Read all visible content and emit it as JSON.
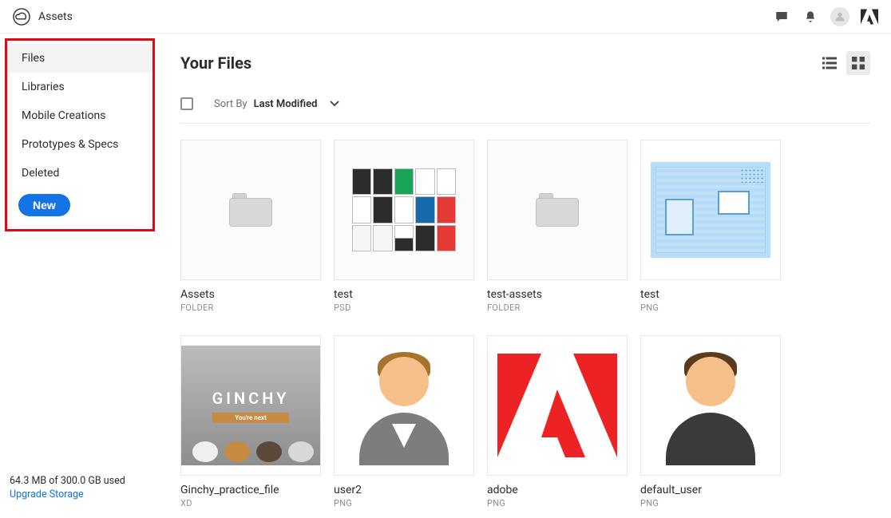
{
  "app_title": "Assets",
  "sidebar": {
    "items": [
      "Files",
      "Libraries",
      "Mobile Creations",
      "Prototypes & Specs",
      "Deleted"
    ],
    "active_index": 0,
    "new_button_label": "New"
  },
  "storage": {
    "usage_text": "64.3 MB of 300.0 GB used",
    "upgrade_text": "Upgrade Storage"
  },
  "main": {
    "title": "Your Files",
    "sort_by_label": "Sort By",
    "sort_by_value": "Last Modified",
    "view_mode": "grid"
  },
  "files": [
    {
      "name": "Assets",
      "type": "FOLDER",
      "kind": "folder"
    },
    {
      "name": "test",
      "type": "PSD",
      "kind": "psd"
    },
    {
      "name": "test-assets",
      "type": "FOLDER",
      "kind": "folder"
    },
    {
      "name": "test",
      "type": "PNG",
      "kind": "illustration"
    },
    {
      "name": "Ginchy_practice_file",
      "type": "XD",
      "kind": "ginchy",
      "overlay_text": "GINCHY",
      "overlay_sub": "You're next"
    },
    {
      "name": "user2",
      "type": "PNG",
      "kind": "user1"
    },
    {
      "name": "adobe",
      "type": "PNG",
      "kind": "adobe"
    },
    {
      "name": "default_user",
      "type": "PNG",
      "kind": "user2"
    }
  ],
  "colors": {
    "highlight_box": "#e30613",
    "primary_button": "#1473e6",
    "adobe_red": "#ed2224"
  }
}
